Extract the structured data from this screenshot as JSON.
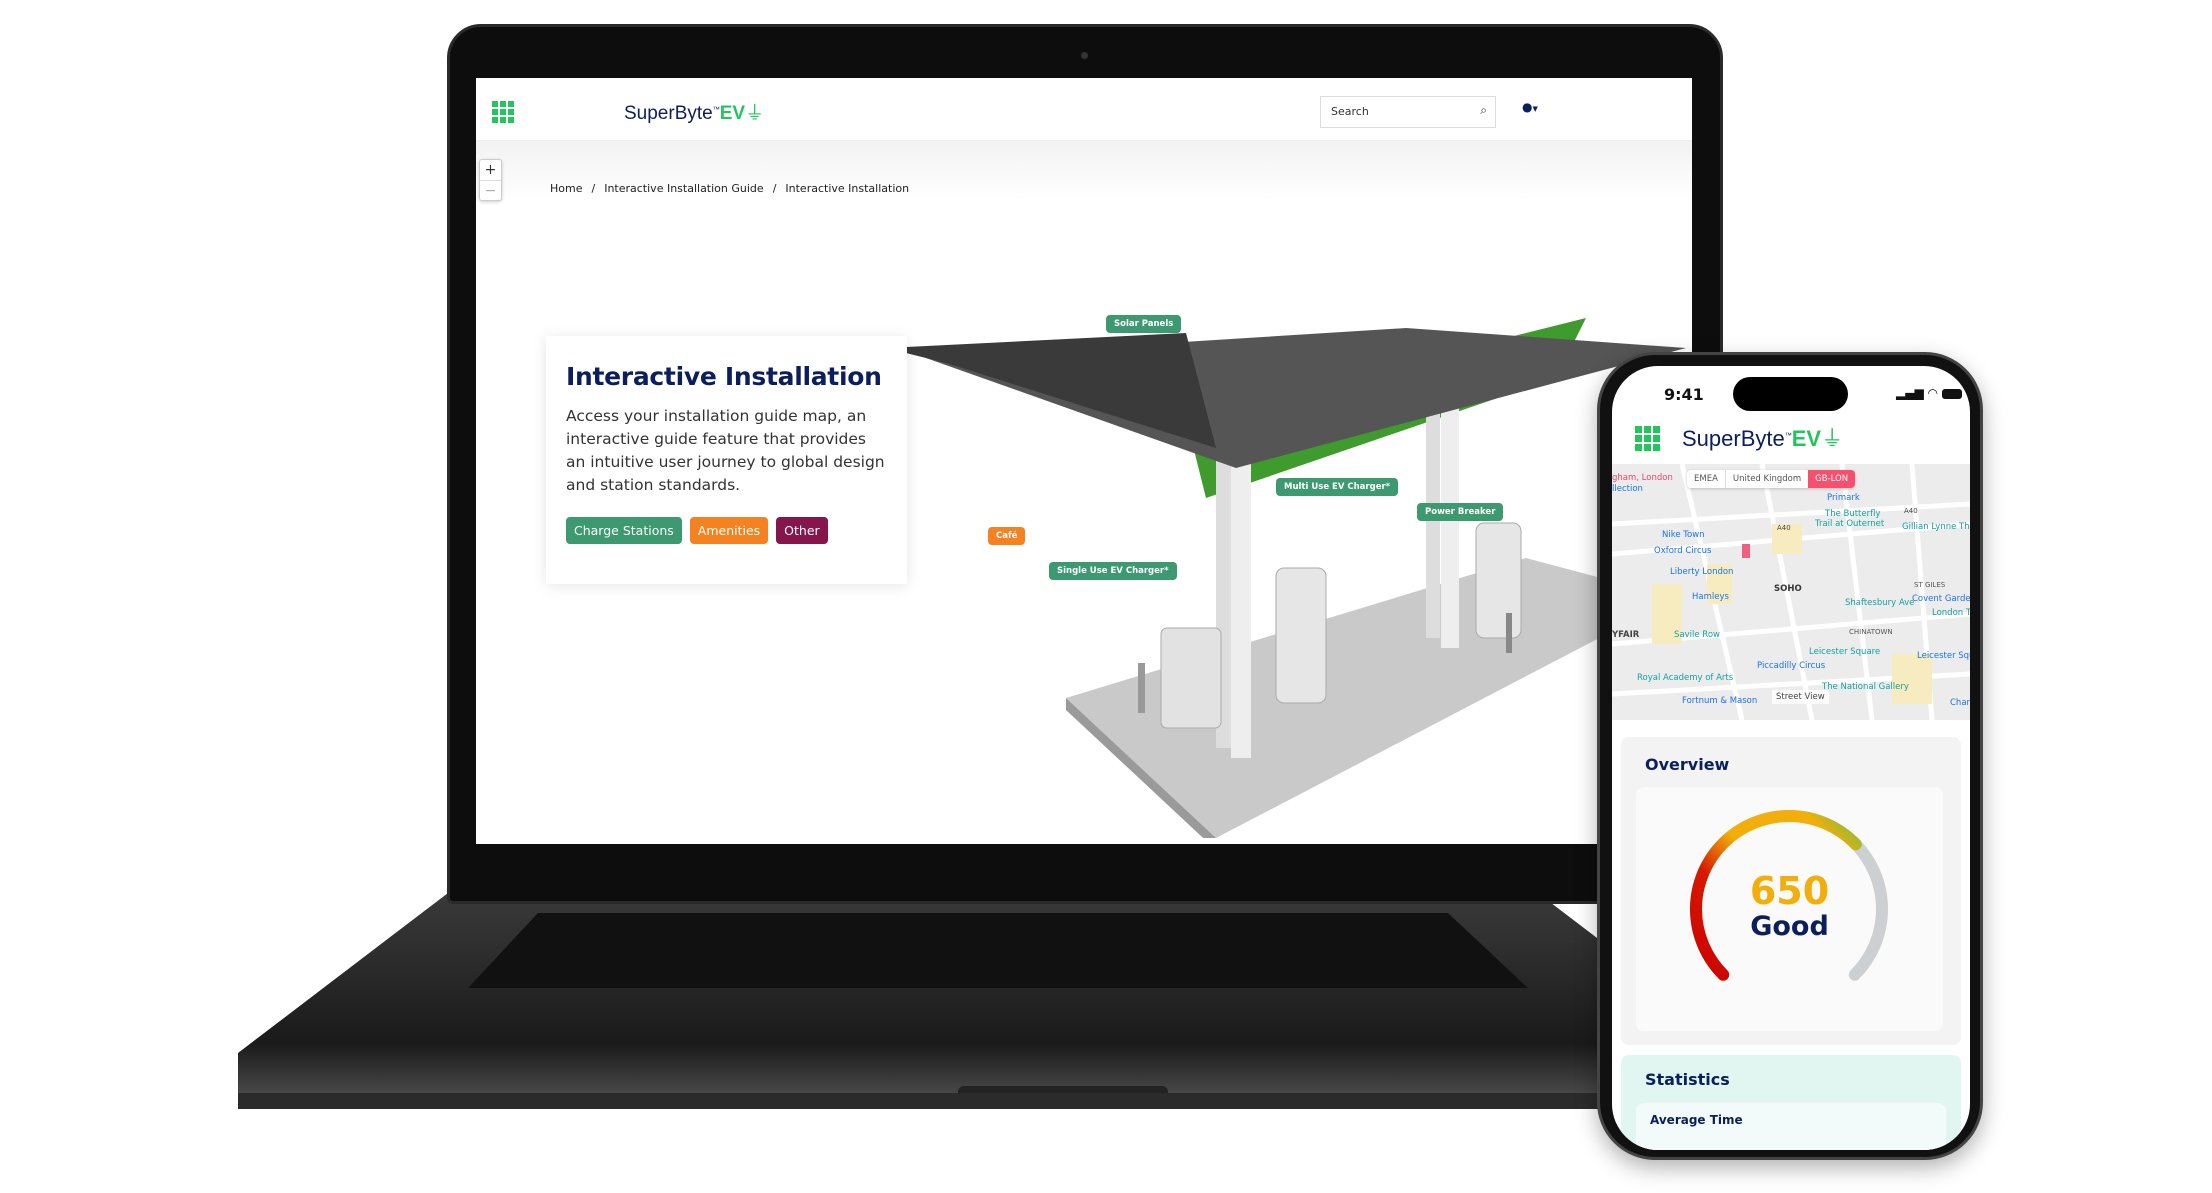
{
  "laptop": {
    "header": {
      "search_placeholder": "Search",
      "logo": {
        "name": "SuperByte",
        "tm": "™",
        "ev": "EV"
      }
    },
    "zoom": {
      "in": "+",
      "out": "−"
    },
    "breadcrumb": [
      "Home",
      "/",
      "Interactive Installation Guide",
      "/",
      "Interactive Installation"
    ],
    "card": {
      "title": "Interactive Installation",
      "body": "Access your installation guide map, an interactive guide feature that provides an intuitive user journey to global design and station standards.",
      "tags": [
        {
          "label": "Charge Stations",
          "color": "#3d9970"
        },
        {
          "label": "Amenities",
          "color": "#f58220"
        },
        {
          "label": "Other",
          "color": "#85154a"
        }
      ]
    },
    "hotspots": {
      "solar": "Solar Panels",
      "multi": "Multi Use EV Charger*",
      "breaker": "Power Breaker",
      "cafe": "Café",
      "single": "Single Use EV Charger*"
    }
  },
  "phone": {
    "status": {
      "time": "9:41"
    },
    "logo": {
      "name": "SuperByte",
      "tm": "™",
      "ev": "EV"
    },
    "map": {
      "chips": [
        "EMEA",
        "United Kingdom",
        "GB-LON"
      ],
      "labels": [
        "gham, London",
        "llection",
        "Primark",
        "A40",
        "The Butterfly",
        "Trail at Outernet",
        "Gillian Lynne The",
        "Nike Town",
        "Oxford Circus",
        "A40",
        "Liberty London",
        "Hamleys",
        "SOHO",
        "ST GILES",
        "Shaftesbury Ave",
        "Covent Garden",
        "London T",
        "YFAIR",
        "Savile Row",
        "CHINATOWN",
        "Leicester Squa",
        "Leicester Square",
        "Piccadilly Circus",
        "Royal Academy of Arts",
        "The National Gallery",
        "Fortnum & Mason",
        "Street View",
        "Char"
      ]
    },
    "overview": {
      "title": "Overview",
      "value": "650",
      "rating": "Good",
      "gauge_fill": 0.67,
      "colors": {
        "value": "#f2ae0a",
        "rating": "#0b1f5c",
        "track": "#ccd0d3"
      }
    },
    "statistics": {
      "title": "Statistics",
      "item": "Average Time"
    }
  }
}
